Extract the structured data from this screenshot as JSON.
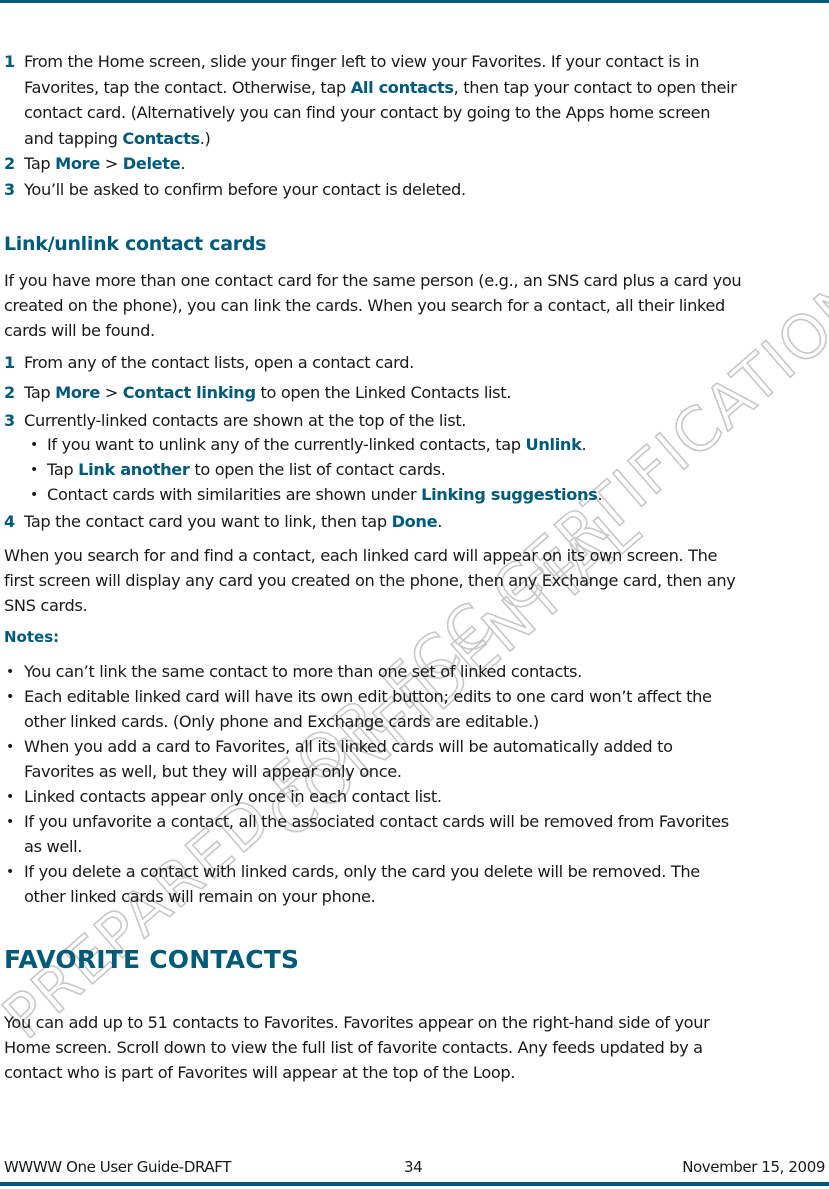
{
  "page": {
    "accent_color": "#005a7a"
  },
  "section1": {
    "steps": [
      {
        "num": "1",
        "lines": [
          [
            {
              "t": "From the Home screen, slide your finger left to view your Favorites. If your contact is in"
            }
          ],
          [
            {
              "t": "Favorites, tap the contact. Otherwise, tap "
            },
            {
              "t": "All contacts",
              "hl": true
            },
            {
              "t": ", then tap your contact to open their"
            }
          ],
          [
            {
              "t": "contact card. (Alternatively you can find your contact by going to the Apps home screen"
            }
          ],
          [
            {
              "t": "and tapping "
            },
            {
              "t": "Contacts",
              "hl": true
            },
            {
              "t": ".)"
            }
          ]
        ]
      },
      {
        "num": "2",
        "lines": [
          [
            {
              "t": "Tap "
            },
            {
              "t": "More",
              "hl": true
            },
            {
              "t": " > "
            },
            {
              "t": "Delete",
              "hl": true
            },
            {
              "t": "."
            }
          ]
        ]
      },
      {
        "num": "3",
        "lines": [
          [
            {
              "t": "You’ll be asked to confirm before your contact is deleted."
            }
          ]
        ]
      }
    ]
  },
  "link_section": {
    "heading": "Link/unlink contact cards",
    "intro_lines": [
      "If you have more than one contact card for the same person (e.g., an SNS card plus a card you",
      "created on the phone), you can link the cards. When you search for a contact, all their linked",
      "cards will be found."
    ],
    "steps": [
      {
        "num": "1",
        "parts": [
          {
            "t": "From any of the contact lists, open a contact card."
          }
        ]
      },
      {
        "num": "2",
        "parts": [
          {
            "t": "Tap "
          },
          {
            "t": "More",
            "hl": true
          },
          {
            "t": " > "
          },
          {
            "t": "Contact linking",
            "hl": true
          },
          {
            "t": " to open the Linked Contacts list."
          }
        ]
      },
      {
        "num": "3",
        "parts": [
          {
            "t": "Currently-linked contacts are shown at the top of the list."
          }
        ]
      },
      {
        "num": "4",
        "parts": [
          {
            "t": "Tap the contact card you want to link, then tap "
          },
          {
            "t": "Done",
            "hl": true
          },
          {
            "t": "."
          }
        ]
      }
    ],
    "sub_bullets": [
      [
        {
          "t": "If you want to unlink any of the currently-linked contacts, tap "
        },
        {
          "t": "Unlink",
          "hl": true
        },
        {
          "t": "."
        }
      ],
      [
        {
          "t": "Tap "
        },
        {
          "t": "Link another",
          "hl": true
        },
        {
          "t": " to open the list of contact cards."
        }
      ],
      [
        {
          "t": "Contact cards with similarities are shown under "
        },
        {
          "t": "Linking suggestions",
          "hl": true
        },
        {
          "t": "."
        }
      ]
    ],
    "search_lines": [
      "When you search for and find a contact, each linked card will appear on its own screen. The",
      "first screen will display any card you created on the phone, then any Exchange card, then any",
      "SNS cards."
    ],
    "notes_label": "Notes:",
    "notes": [
      [
        "You can’t link the same contact to more than one set of linked contacts."
      ],
      [
        "Each editable linked card will have its own edit button; edits to one card won’t affect the",
        "other linked cards. (Only phone and Exchange cards are editable.)"
      ],
      [
        "When you add a card to Favorites, all its linked cards will be automatically added to",
        "Favorites as well, but they will appear only once."
      ],
      [
        "Linked contacts appear only once in each contact list."
      ],
      [
        "If you unfavorite a contact, all the associated contact cards will be removed from Favorites",
        "as well."
      ],
      [
        "If you delete a contact with linked cards, only the card you delete will be removed. The",
        "other linked cards will remain on your phone."
      ]
    ]
  },
  "favorites_section": {
    "heading": "FAVORITE CONTACTS",
    "lines": [
      "You can add up to 51 contacts to Favorites. Favorites appear on the right-hand side of your",
      "Home screen. Scroll down to view the full list of favorite contacts. Any feeds updated by a",
      "contact who is part of Favorites will appear at the top of the Loop."
    ]
  },
  "footer": {
    "left": "WWWW One User Guide-DRAFT",
    "center": "34",
    "right": "November 15, 2009"
  },
  "watermark": {
    "line1": "PREPARED FOR FCC CERTIFICATION",
    "line2": "CONFIDENTIAL"
  }
}
